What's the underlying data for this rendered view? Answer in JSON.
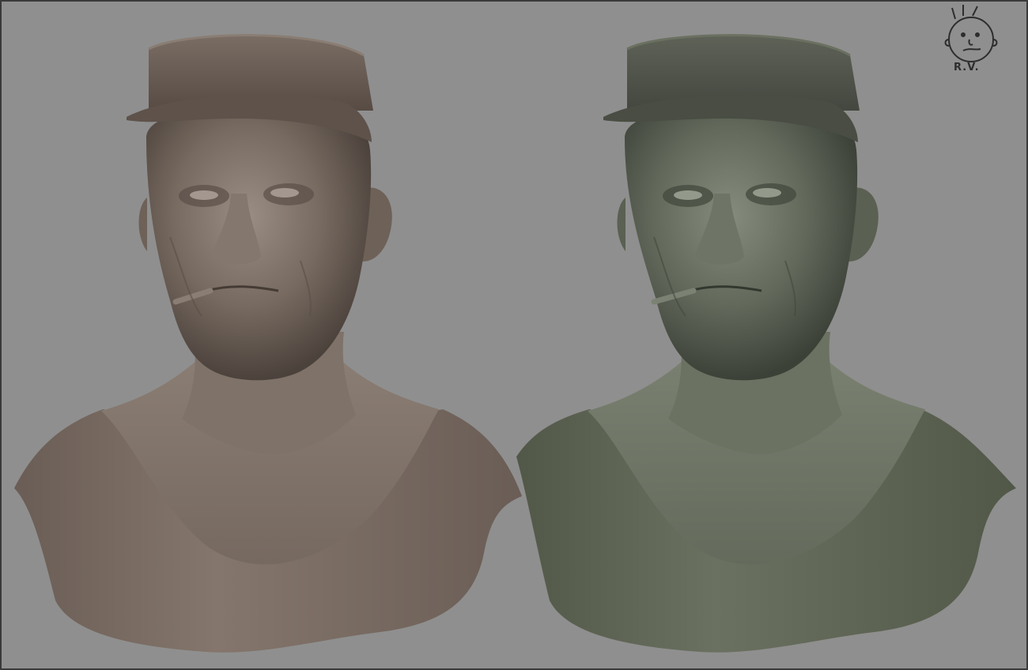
{
  "scene": {
    "background_color": "#8f8f8f",
    "frame_color": "#3a3a3a"
  },
  "busts": [
    {
      "material": "clay-brown",
      "skin_light": "#8f8278",
      "skin_mid": "#716459",
      "skin_dark": "#4a403a",
      "cap_color": "#6d6058",
      "shirt_color": "#7a6b61"
    },
    {
      "material": "clay-green",
      "skin_light": "#7c8273",
      "skin_mid": "#5f6658",
      "skin_dark": "#3a3f36",
      "cap_color": "#55594e",
      "shirt_color": "#626857"
    }
  ],
  "signature": {
    "text": "R.V.",
    "icon": "cartoon-face-icon"
  }
}
